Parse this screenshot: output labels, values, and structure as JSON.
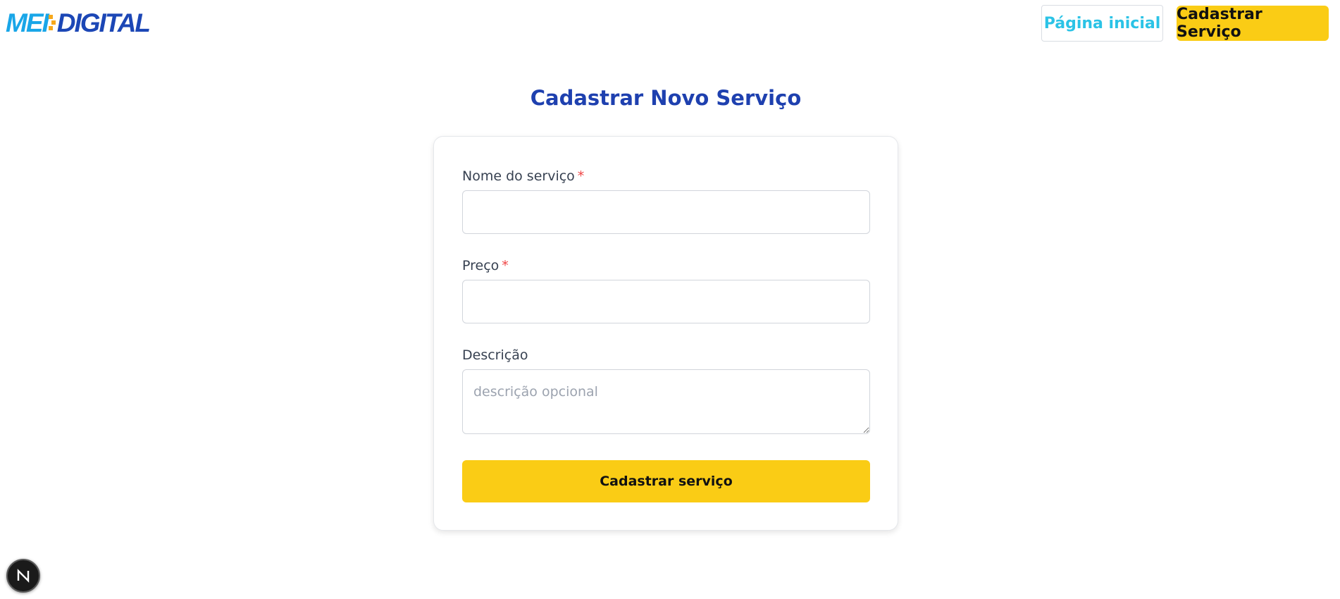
{
  "header": {
    "logo": {
      "part1": "MEI",
      "part2": "DIGITAL"
    },
    "nav": {
      "home_label": "Página inicial",
      "cadastrar_label": "Cadastrar Serviço"
    }
  },
  "page": {
    "title": "Cadastrar Novo Serviço"
  },
  "form": {
    "name": {
      "label": "Nome do serviço",
      "required_mark": "*",
      "value": ""
    },
    "price": {
      "label": "Preço",
      "required_mark": "*",
      "value": ""
    },
    "description": {
      "label": "Descrição",
      "placeholder": "descrição opcional",
      "value": ""
    },
    "submit_label": "Cadastrar serviço"
  },
  "dev_badge": {
    "letter": "N",
    "icon": "nextjs-icon"
  },
  "colors": {
    "brand_blue": "#1e40af",
    "logo_light_blue": "#19a6e8",
    "logo_orange": "#f7a81b",
    "accent_yellow": "#facc15",
    "home_link_cyan": "#2bc3e6",
    "required_red": "#ef4444"
  }
}
